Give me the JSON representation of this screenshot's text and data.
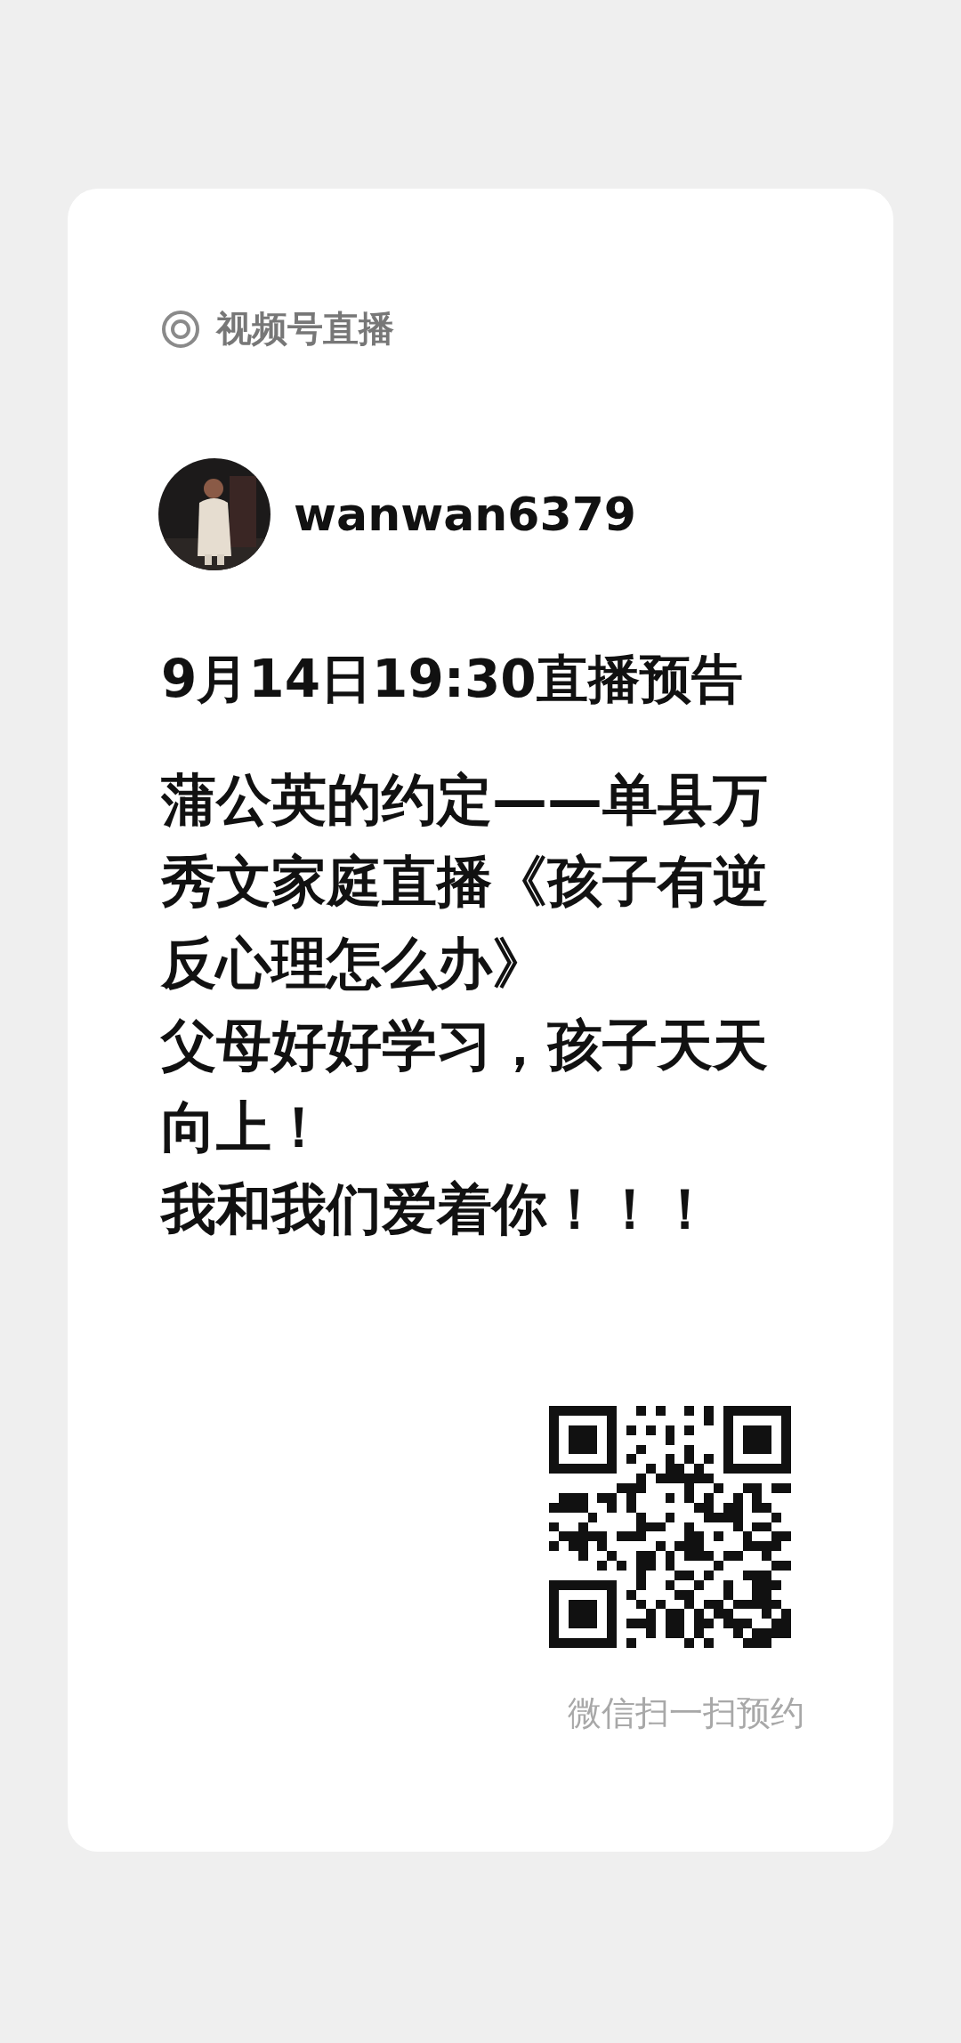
{
  "header": {
    "label": "视频号直播"
  },
  "author": {
    "name": "wanwan6379"
  },
  "title": "9月14日19:30直播预告",
  "body": [
    "蒲公英的约定——单县万秀文家庭直播《孩子有逆反心理怎么办》",
    "父母好好学习，孩子天天向上！",
    "我和我们爱着你！！！"
  ],
  "qr_caption": "微信扫一扫预约"
}
